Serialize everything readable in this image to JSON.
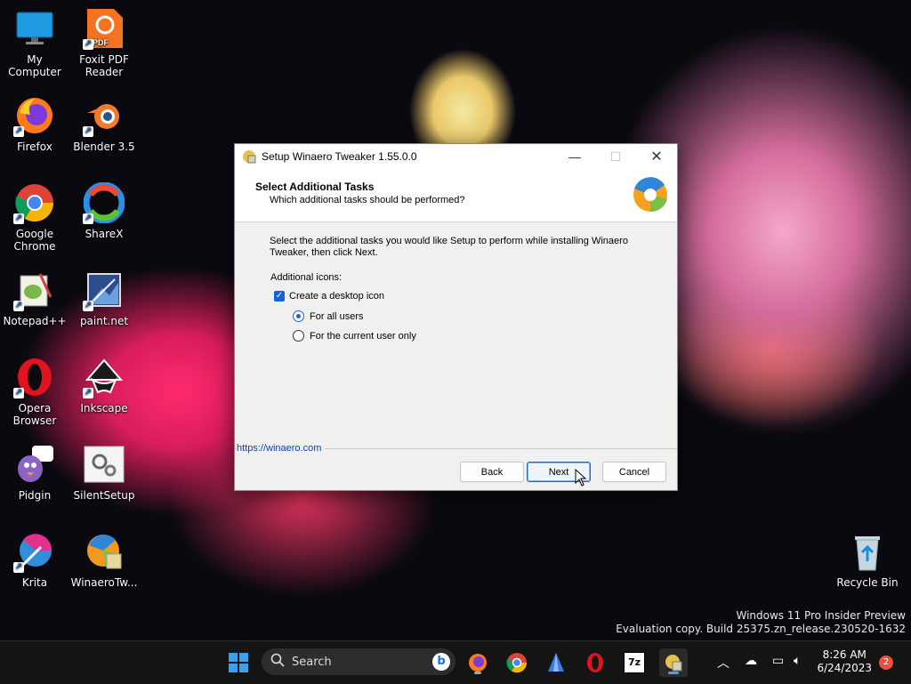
{
  "desktop": {
    "icons": [
      {
        "label": "My Computer"
      },
      {
        "label": "Foxit PDF Reader"
      },
      {
        "label": "Firefox"
      },
      {
        "label": "Blender 3.5"
      },
      {
        "label": "Google Chrome"
      },
      {
        "label": "ShareX"
      },
      {
        "label": "Notepad++"
      },
      {
        "label": "paint.net"
      },
      {
        "label": "Opera Browser"
      },
      {
        "label": "Inkscape"
      },
      {
        "label": "Pidgin"
      },
      {
        "label": "SilentSetup"
      },
      {
        "label": "Krita"
      },
      {
        "label": "WinaeroTw..."
      },
      {
        "label": "Recycle Bin"
      }
    ],
    "watermark_line1": "Windows 11 Pro Insider Preview",
    "watermark_line2": "Evaluation copy. Build 25375.zn_release.230520-1632"
  },
  "dialog": {
    "title": "Setup Winaero Tweaker 1.55.0.0",
    "heading": "Select Additional Tasks",
    "subheading": "Which additional tasks should be performed?",
    "description": "Select the additional tasks you would like Setup to perform while installing Winaero Tweaker, then click Next.",
    "group_label": "Additional icons:",
    "checkbox_label": "Create a desktop icon",
    "checkbox_checked": true,
    "radio_all_users": "For all users",
    "radio_current_user": "For the current user only",
    "selected_radio": "For all users",
    "link": "https://winaero.com",
    "back_label": "Back",
    "next_label": "Next",
    "cancel_label": "Cancel"
  },
  "taskbar": {
    "search_label": "Search",
    "time": "8:26 AM",
    "date": "6/24/2023",
    "notification_count": "2",
    "apps": [
      "windows-start-icon",
      "firefox-icon",
      "chrome-icon",
      "app-icon",
      "opera-icon",
      "7zip-icon",
      "winaero-setup-icon"
    ]
  },
  "colors": {
    "accent": "#1464d8",
    "link": "#0645ad",
    "taskbar": "#141414"
  }
}
